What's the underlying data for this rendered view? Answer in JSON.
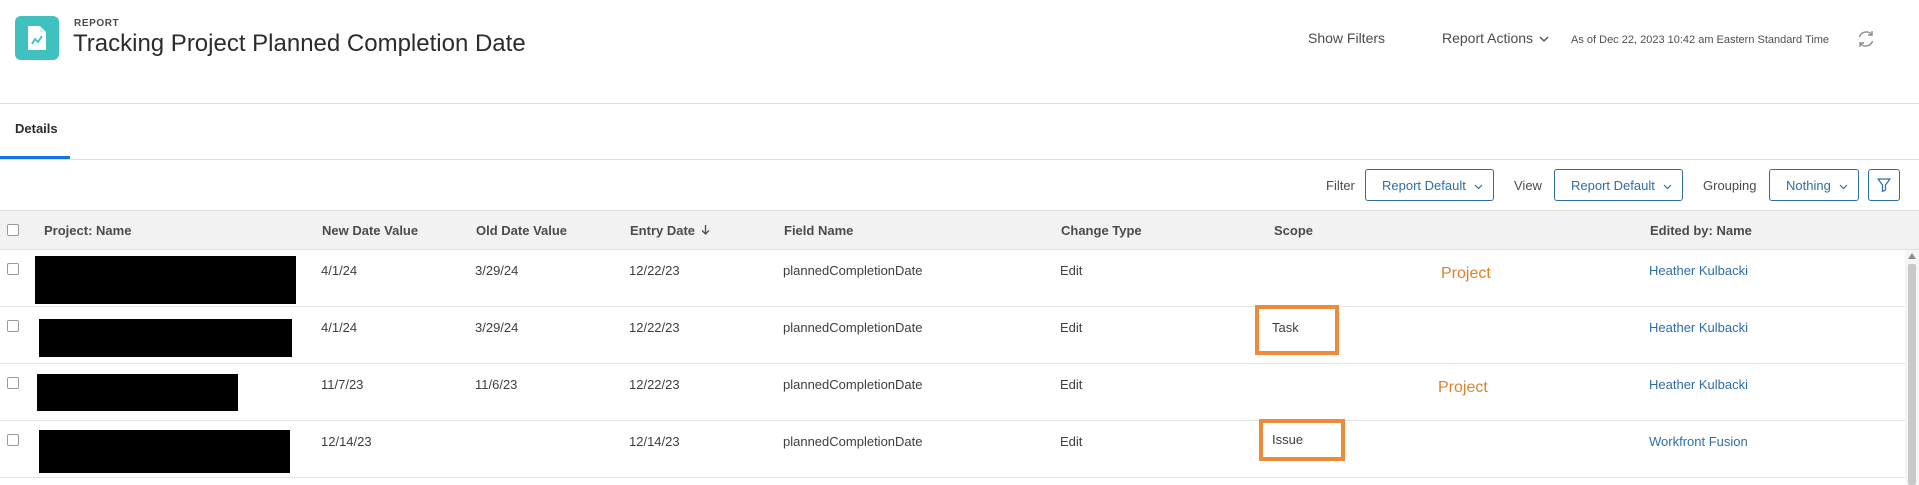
{
  "header": {
    "kicker": "REPORT",
    "title": "Tracking Project Planned Completion Date",
    "show_filters": "Show Filters",
    "report_actions": "Report Actions",
    "as_of": "As of Dec 22, 2023 10:42 am Eastern Standard Time",
    "icons": {
      "app": "report-icon",
      "refresh": "refresh-icon",
      "dropdown": "chevron-down-icon"
    }
  },
  "tabs": [
    {
      "label": "Details",
      "active": true
    }
  ],
  "toolbar": {
    "filter_label": "Filter",
    "filter_value": "Report Default",
    "view_label": "View",
    "view_value": "Report Default",
    "grouping_label": "Grouping",
    "grouping_value": "Nothing",
    "filter_icon": "funnel-icon"
  },
  "table": {
    "columns": [
      "Project: Name",
      "New Date Value",
      "Old Date Value",
      "Entry Date",
      "Field Name",
      "Change Type",
      "Scope",
      "Edited by: Name"
    ],
    "sort": {
      "column": "Entry Date",
      "direction": "descending"
    },
    "rows": [
      {
        "project": "",
        "new_date": "4/1/24",
        "old_date": "3/29/24",
        "entry_date": "12/22/23",
        "field": "plannedCompletionDate",
        "change": "Edit",
        "scope": "",
        "edited_by": "Heather Kulbacki"
      },
      {
        "project": "",
        "new_date": "4/1/24",
        "old_date": "3/29/24",
        "entry_date": "12/22/23",
        "field": "plannedCompletionDate",
        "change": "Edit",
        "scope": "Task",
        "edited_by": "Heather Kulbacki"
      },
      {
        "project": "",
        "new_date": "11/7/23",
        "old_date": "11/6/23",
        "entry_date": "12/22/23",
        "field": "plannedCompletionDate",
        "change": "Edit",
        "scope": "",
        "edited_by": "Heather Kulbacki"
      },
      {
        "project": "",
        "new_date": "12/14/23",
        "old_date": "",
        "entry_date": "12/14/23",
        "field": "plannedCompletionDate",
        "change": "Edit",
        "scope": "Issue",
        "edited_by": "Workfront Fusion"
      }
    ]
  },
  "annotations": {
    "row1_scope_note": "Project",
    "row3_scope_note": "Project",
    "highlight_color": "#ec8b3a"
  }
}
